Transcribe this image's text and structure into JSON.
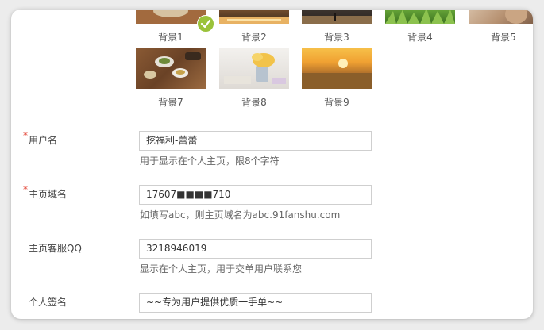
{
  "backgrounds": {
    "items": [
      {
        "label": "背景1",
        "selected": true
      },
      {
        "label": "背景2"
      },
      {
        "label": "背景3"
      },
      {
        "label": "背景4"
      },
      {
        "label": "背景5"
      },
      {
        "label": "背景7"
      },
      {
        "label": "背景8"
      },
      {
        "label": "背景9"
      }
    ],
    "selected_color": "#9ac23a"
  },
  "form": {
    "username": {
      "label": "用户名",
      "required": "*",
      "value": "挖福利-蕾蕾",
      "help": "用于显示在个人主页，限8个字符"
    },
    "domain": {
      "label": "主页域名",
      "required": "*",
      "value": "17607■■■■710",
      "help": "如填写abc，则主页域名为abc.91fanshu.com"
    },
    "qq": {
      "label": "主页客服QQ",
      "value": "3218946019",
      "help": "显示在个人主页，用于交单用户联系您"
    },
    "signature": {
      "label": "个人签名",
      "value": "~~专为用户提供优质一手单~~"
    }
  },
  "colors": {
    "required": "#e23c2c",
    "check": "#9ac23a"
  }
}
